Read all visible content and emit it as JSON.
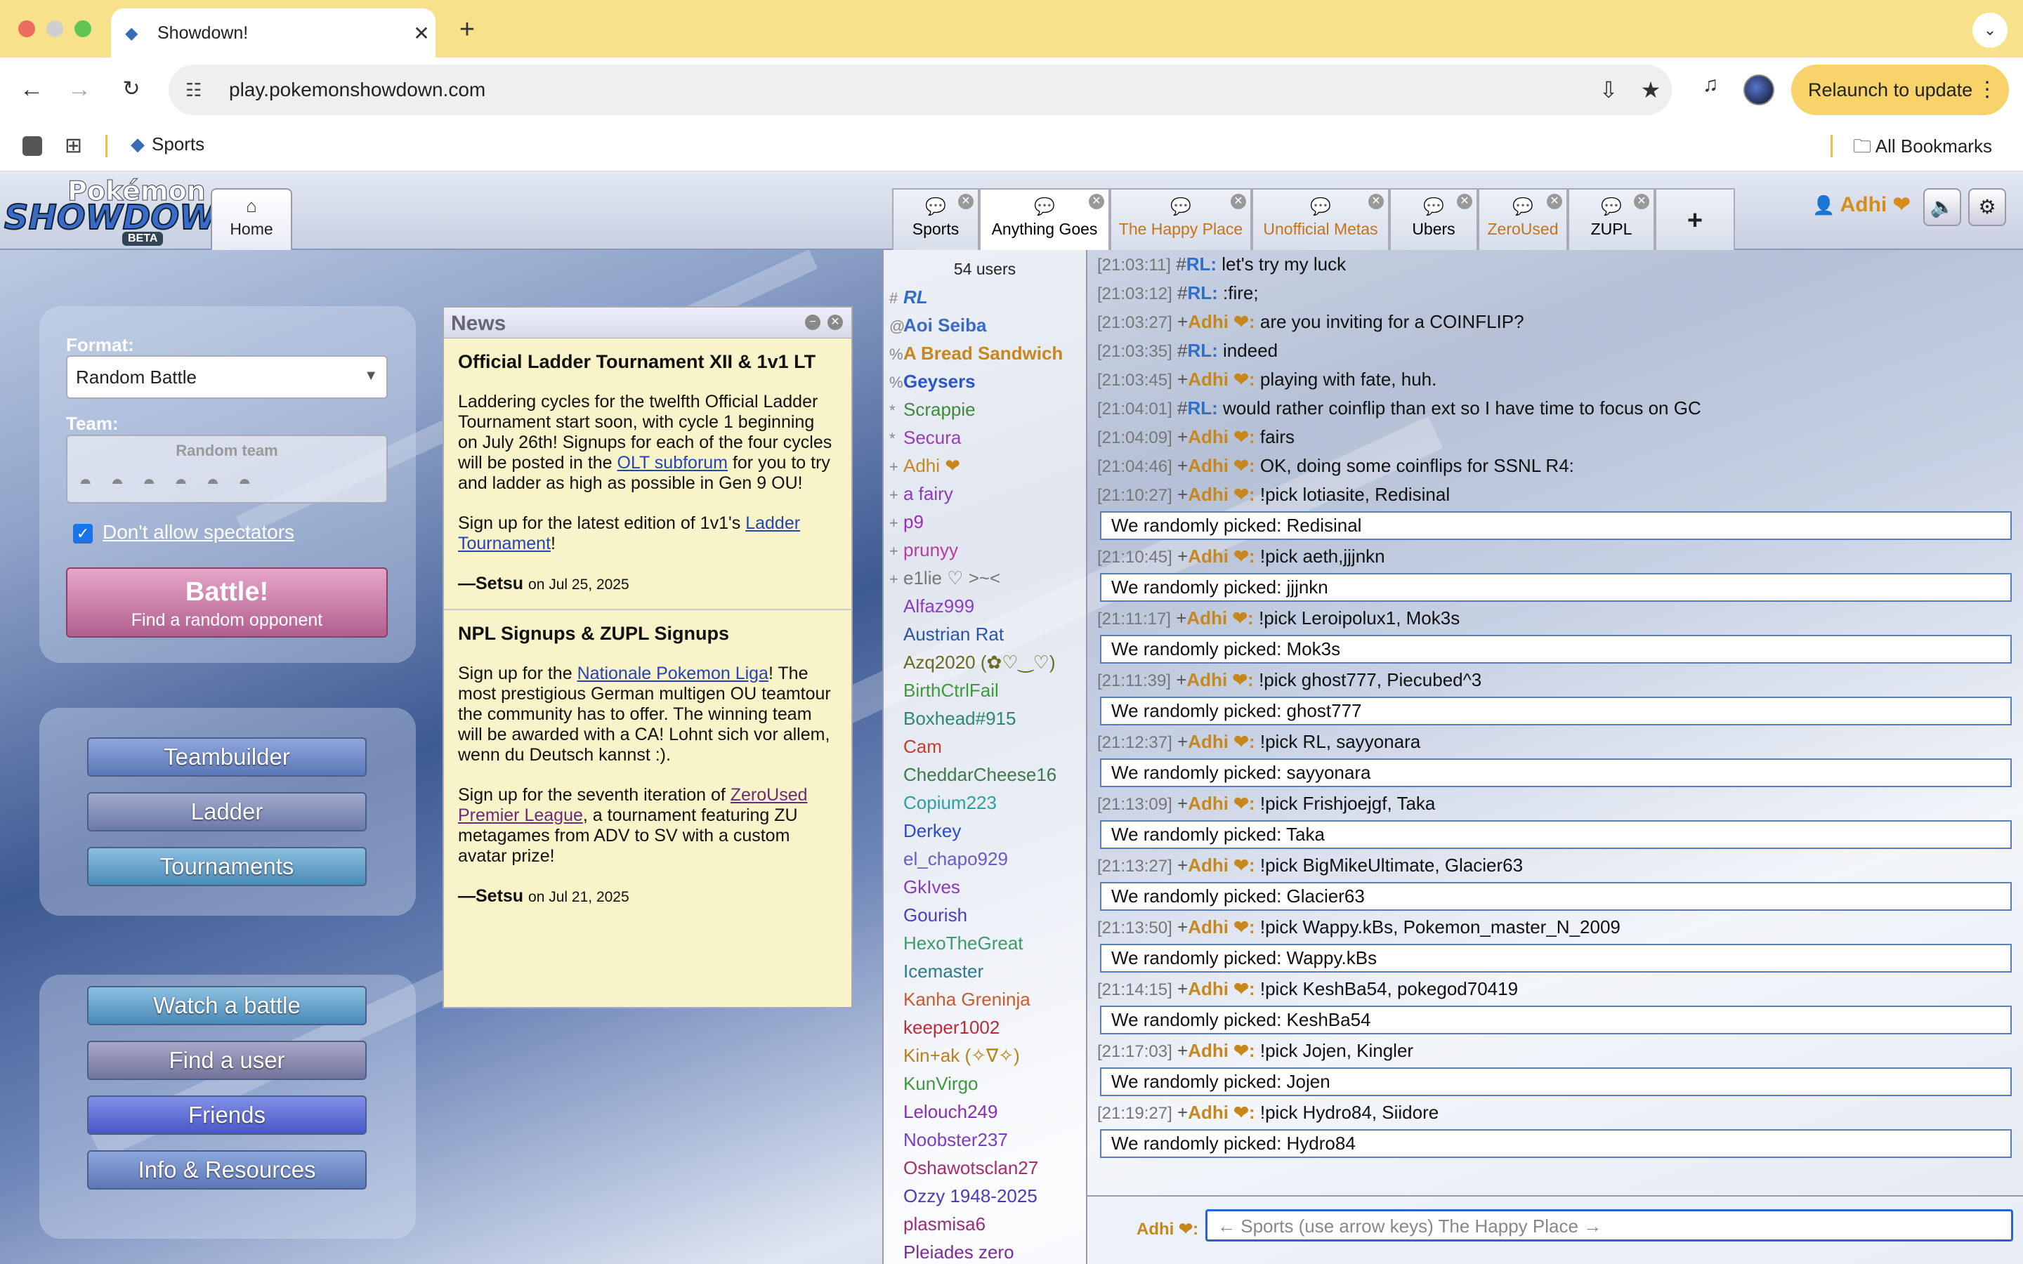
{
  "browser": {
    "tab_title": "Showdown!",
    "url": "play.pokemonshowdown.com",
    "relaunch_label": "Relaunch to update",
    "bookmark_sports": "Sports",
    "all_bookmarks": "All Bookmarks",
    "accent_color": "#f7e18a"
  },
  "header": {
    "logo_line1": "Pokémon",
    "logo_line2": "SHOWDOWN",
    "logo_beta": "BETA",
    "home_label": "Home",
    "rooms": [
      {
        "label": "Sports",
        "color": "#222"
      },
      {
        "label": "Anything Goes",
        "color": "#222"
      },
      {
        "label": "The Happy Place",
        "color": "#c6741b"
      },
      {
        "label": "Unofficial Metas",
        "color": "#c6741b"
      },
      {
        "label": "Ubers",
        "color": "#222"
      },
      {
        "label": "ZeroUsed",
        "color": "#c6741b"
      },
      {
        "label": "ZUPL",
        "color": "#222"
      }
    ],
    "plus_label": "+",
    "username": "Adhi",
    "username_badge": "❤"
  },
  "menu": {
    "format_label": "Format:",
    "format_value": "Random Battle",
    "team_label": "Team:",
    "team_value": "Random team",
    "spectators_label": "Don't allow spectators",
    "battle_label": "Battle!",
    "battle_sub": "Find a random opponent",
    "teambuilder": "Teambuilder",
    "ladder": "Ladder",
    "tournaments": "Tournaments",
    "watch": "Watch a battle",
    "find_user": "Find a user",
    "friends": "Friends",
    "info": "Info & Resources"
  },
  "news": {
    "title": "News",
    "item1_title": "Official Ladder Tournament XII & 1v1 LT",
    "item1_p1a": "Laddering cycles for the twelfth Official Ladder Tournament start soon, with cycle 1 beginning on July 26th! Signups for each of the four cycles will be posted in the ",
    "item1_link1": "OLT subforum",
    "item1_p1b": " for you to try and ladder as high as possible in Gen 9 OU!",
    "item1_p2a": "Sign up for the latest edition of 1v1's ",
    "item1_link2": "Ladder Tournament",
    "item1_p2b": "!",
    "item1_author": "—Setsu",
    "item1_date": "on Jul 25, 2025",
    "item2_title": "NPL Signups & ZUPL Signups",
    "item2_p1a": "Sign up for the ",
    "item2_link1": "Nationale Pokemon Liga",
    "item2_p1b": "! The most prestigious German multigen OU teamtour the community has to offer. The winning team will be awarded with a CA! Lohnt sich vor allem, wenn du Deutsch kannst :).",
    "item2_p2a": "Sign up for the seventh iteration of ",
    "item2_link2": "ZeroUsed Premier League",
    "item2_p2b": ", a tournament featuring ZU metagames from ADV to SV with a custom avatar prize!",
    "item2_author": "—Setsu",
    "item2_date": "on Jul 21, 2025"
  },
  "users": {
    "count": "54 users",
    "list": [
      {
        "rank": "#",
        "name": "RL",
        "color": "#2f6fc8",
        "style": "bolditalic"
      },
      {
        "rank": "@",
        "name": "Aoi Seiba",
        "color": "#3b6bc8",
        "style": "bold"
      },
      {
        "rank": "%",
        "name": "A Bread Sandwich",
        "color": "#c8871c",
        "style": "bold"
      },
      {
        "rank": "%",
        "name": "Geysers",
        "color": "#2b55cc",
        "style": "bold"
      },
      {
        "rank": "*",
        "name": "Scrappie",
        "color": "#3c8a3c",
        "style": ""
      },
      {
        "rank": "*",
        "name": "Secura",
        "color": "#9a3cb8",
        "style": ""
      },
      {
        "rank": "+",
        "name": "Adhi ❤",
        "color": "#c8871c",
        "style": ""
      },
      {
        "rank": "+",
        "name": "a fairy",
        "color": "#8a3cb8",
        "style": ""
      },
      {
        "rank": "+",
        "name": "p9",
        "color": "#9a2cb8",
        "style": ""
      },
      {
        "rank": "+",
        "name": "prunyy",
        "color": "#b83ca0",
        "style": ""
      },
      {
        "rank": "+",
        "name": "e1lie ♡ >~<",
        "color": "#777",
        "style": ""
      },
      {
        "rank": "",
        "name": "Alfaz999",
        "color": "#8a3cc8",
        "style": ""
      },
      {
        "rank": "",
        "name": "Austrian Rat",
        "color": "#2b55a8",
        "style": ""
      },
      {
        "rank": "",
        "name": "Azq2020 (✿♡‿♡)",
        "color": "#6b6b1e",
        "style": ""
      },
      {
        "rank": "",
        "name": "BirthCtrlFail",
        "color": "#3c9a3c",
        "style": ""
      },
      {
        "rank": "",
        "name": "Boxhead#915",
        "color": "#2c8a6c",
        "style": ""
      },
      {
        "rank": "",
        "name": "Cam",
        "color": "#c83c2c",
        "style": ""
      },
      {
        "rank": "",
        "name": "CheddarCheese16",
        "color": "#3c7a4c",
        "style": ""
      },
      {
        "rank": "",
        "name": "Copium223",
        "color": "#2ca0a0",
        "style": ""
      },
      {
        "rank": "",
        "name": "Derkey",
        "color": "#2b4bc8",
        "style": ""
      },
      {
        "rank": "",
        "name": "el_chapo929",
        "color": "#6a5ac8",
        "style": ""
      },
      {
        "rank": "",
        "name": "GkIves",
        "color": "#8a3cb8",
        "style": ""
      },
      {
        "rank": "",
        "name": "Gourish",
        "color": "#4a3cc8",
        "style": ""
      },
      {
        "rank": "",
        "name": "HexoTheGreat",
        "color": "#3c9a6c",
        "style": ""
      },
      {
        "rank": "",
        "name": "Icemaster",
        "color": "#2c7a8a",
        "style": ""
      },
      {
        "rank": "",
        "name": "Kanha Greninja",
        "color": "#c85a2c",
        "style": ""
      },
      {
        "rank": "",
        "name": "keeper1002",
        "color": "#b82c3c",
        "style": ""
      },
      {
        "rank": "",
        "name": "Kin+ak (✧∇✧)",
        "color": "#b8801c",
        "style": ""
      },
      {
        "rank": "",
        "name": "KunVirgo",
        "color": "#3c9a3c",
        "style": ""
      },
      {
        "rank": "",
        "name": "Lelouch249",
        "color": "#8a2cb8",
        "style": ""
      },
      {
        "rank": "",
        "name": "Noobster237",
        "color": "#7a3cc8",
        "style": ""
      },
      {
        "rank": "",
        "name": "Oshawotsclan27",
        "color": "#a82c6c",
        "style": ""
      },
      {
        "rank": "",
        "name": "Ozzy 1948-2025",
        "color": "#4a3cb8",
        "style": ""
      },
      {
        "rank": "",
        "name": "plasmisa6",
        "color": "#9a2c7a",
        "style": ""
      },
      {
        "rank": "",
        "name": "Pleiades zero",
        "color": "#7a2c9a",
        "style": ""
      }
    ]
  },
  "chat": {
    "lines": [
      {
        "type": "msg",
        "ts": "[21:03:11]",
        "sym": "#",
        "name": "RL:",
        "rl": true,
        "text": "let's try my luck"
      },
      {
        "type": "msg",
        "ts": "[21:03:12]",
        "sym": "#",
        "name": "RL:",
        "rl": true,
        "text": ":fire;"
      },
      {
        "type": "msg",
        "ts": "[21:03:27]",
        "sym": "+",
        "name": "Adhi ❤:",
        "rl": false,
        "text": "are you inviting for a COINFLIP?"
      },
      {
        "type": "msg",
        "ts": "[21:03:35]",
        "sym": "#",
        "name": "RL:",
        "rl": true,
        "text": "indeed"
      },
      {
        "type": "msg",
        "ts": "[21:03:45]",
        "sym": "+",
        "name": "Adhi ❤:",
        "rl": false,
        "text": "playing with fate, huh."
      },
      {
        "type": "msg",
        "ts": "[21:04:01]",
        "sym": "#",
        "name": "RL:",
        "rl": true,
        "text": "would rather coinflip than ext so I have time to focus on GC"
      },
      {
        "type": "msg",
        "ts": "[21:04:09]",
        "sym": "+",
        "name": "Adhi ❤:",
        "rl": false,
        "text": "fairs"
      },
      {
        "type": "msg",
        "ts": "[21:04:46]",
        "sym": "+",
        "name": "Adhi ❤:",
        "rl": false,
        "text": "OK, doing some coinflips for SSNL R4:"
      },
      {
        "type": "msg",
        "ts": "[21:10:27]",
        "sym": "+",
        "name": "Adhi ❤:",
        "rl": false,
        "text": "!pick lotiasite, Redisinal"
      },
      {
        "type": "pick",
        "text": "We randomly picked:  Redisinal"
      },
      {
        "type": "msg",
        "ts": "[21:10:45]",
        "sym": "+",
        "name": "Adhi ❤:",
        "rl": false,
        "text": "!pick aeth,jjjnkn"
      },
      {
        "type": "pick",
        "text": "We randomly picked:  jjjnkn"
      },
      {
        "type": "msg",
        "ts": "[21:11:17]",
        "sym": "+",
        "name": "Adhi ❤:",
        "rl": false,
        "text": "!pick Leroipolux1, Mok3s"
      },
      {
        "type": "pick",
        "text": "We randomly picked:  Mok3s"
      },
      {
        "type": "msg",
        "ts": "[21:11:39]",
        "sym": "+",
        "name": "Adhi ❤:",
        "rl": false,
        "text": "!pick ghost777, Piecubed^3"
      },
      {
        "type": "pick",
        "text": "We randomly picked:  ghost777"
      },
      {
        "type": "msg",
        "ts": "[21:12:37]",
        "sym": "+",
        "name": "Adhi ❤:",
        "rl": false,
        "text": "!pick RL, sayyonara"
      },
      {
        "type": "pick",
        "text": "We randomly picked:  sayyonara"
      },
      {
        "type": "msg",
        "ts": "[21:13:09]",
        "sym": "+",
        "name": "Adhi ❤:",
        "rl": false,
        "text": "!pick Frishjoejgf, Taka"
      },
      {
        "type": "pick",
        "text": "We randomly picked:  Taka"
      },
      {
        "type": "msg",
        "ts": "[21:13:27]",
        "sym": "+",
        "name": "Adhi ❤:",
        "rl": false,
        "text": "!pick BigMikeUltimate, Glacier63"
      },
      {
        "type": "pick",
        "text": "We randomly picked:  Glacier63"
      },
      {
        "type": "msg",
        "ts": "[21:13:50]",
        "sym": "+",
        "name": "Adhi ❤:",
        "rl": false,
        "text": "!pick Wappy.kBs, Pokemon_master_N_2009"
      },
      {
        "type": "pick",
        "text": "We randomly picked:  Wappy.kBs"
      },
      {
        "type": "msg",
        "ts": "[21:14:15]",
        "sym": "+",
        "name": "Adhi ❤:",
        "rl": false,
        "text": "!pick KeshBa54, pokegod70419"
      },
      {
        "type": "pick",
        "text": "We randomly picked:  KeshBa54"
      },
      {
        "type": "msg",
        "ts": "[21:17:03]",
        "sym": "+",
        "name": "Adhi ❤:",
        "rl": false,
        "text": "!pick Jojen, Kingler"
      },
      {
        "type": "pick",
        "text": "We randomly picked:  Jojen"
      },
      {
        "type": "msg",
        "ts": "[21:19:27]",
        "sym": "+",
        "name": "Adhi ❤:",
        "rl": false,
        "text": "!pick Hydro84, Siidore"
      },
      {
        "type": "pick",
        "text": "We randomly picked:  Hydro84"
      }
    ],
    "entry_name": "Adhi ❤:",
    "entry_placeholder": "← Sports (use arrow keys) The Happy Place →"
  }
}
